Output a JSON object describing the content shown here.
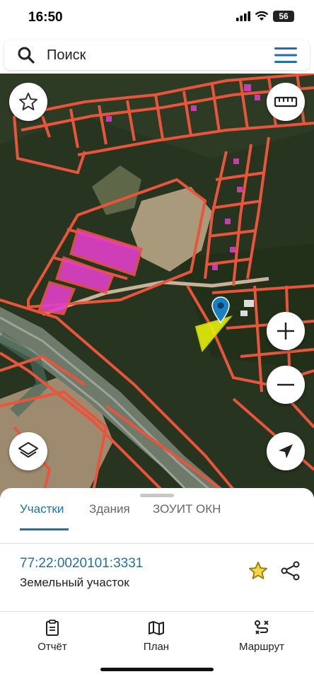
{
  "status_bar": {
    "time": "16:50",
    "battery": "56"
  },
  "search": {
    "placeholder": "Поиск"
  },
  "map": {
    "icons": [
      "star-icon",
      "ruler-icon",
      "location-pin-icon",
      "layers-icon",
      "zoom-in-icon",
      "zoom-out-icon",
      "navigation-arrow-icon"
    ],
    "colors": {
      "parcel_outline": "#e8553c",
      "building_fill": "#e040c8",
      "selected_parcel": "#e6f00c",
      "pin": "#1b7fc4",
      "forest": "#26331f"
    }
  },
  "tabs": [
    {
      "label": "Участки",
      "active": true
    },
    {
      "label": "Здания",
      "active": false
    },
    {
      "label": "ЗОУИТ ОКН",
      "active": false
    }
  ],
  "parcel": {
    "cadastral_number": "77:22:0020101:3331",
    "type": "Земельный участок"
  },
  "bottom_nav": [
    {
      "label": "Отчёт",
      "icon": "report-icon"
    },
    {
      "label": "План",
      "icon": "map-icon"
    },
    {
      "label": "Маршрут",
      "icon": "route-icon"
    }
  ],
  "accent_color": "#1e70b0"
}
